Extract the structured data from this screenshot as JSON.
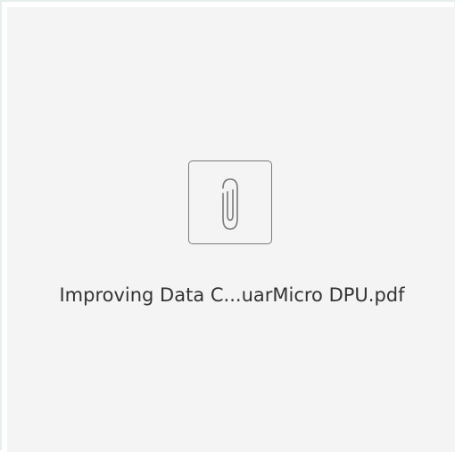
{
  "attachment": {
    "file_name": "Improving Data C...uarMicro DPU.pdf",
    "icon": "paperclip-icon"
  },
  "colors": {
    "card_background": "#f4f4f4",
    "icon_border": "#7a7a7a",
    "text": "#333333"
  }
}
